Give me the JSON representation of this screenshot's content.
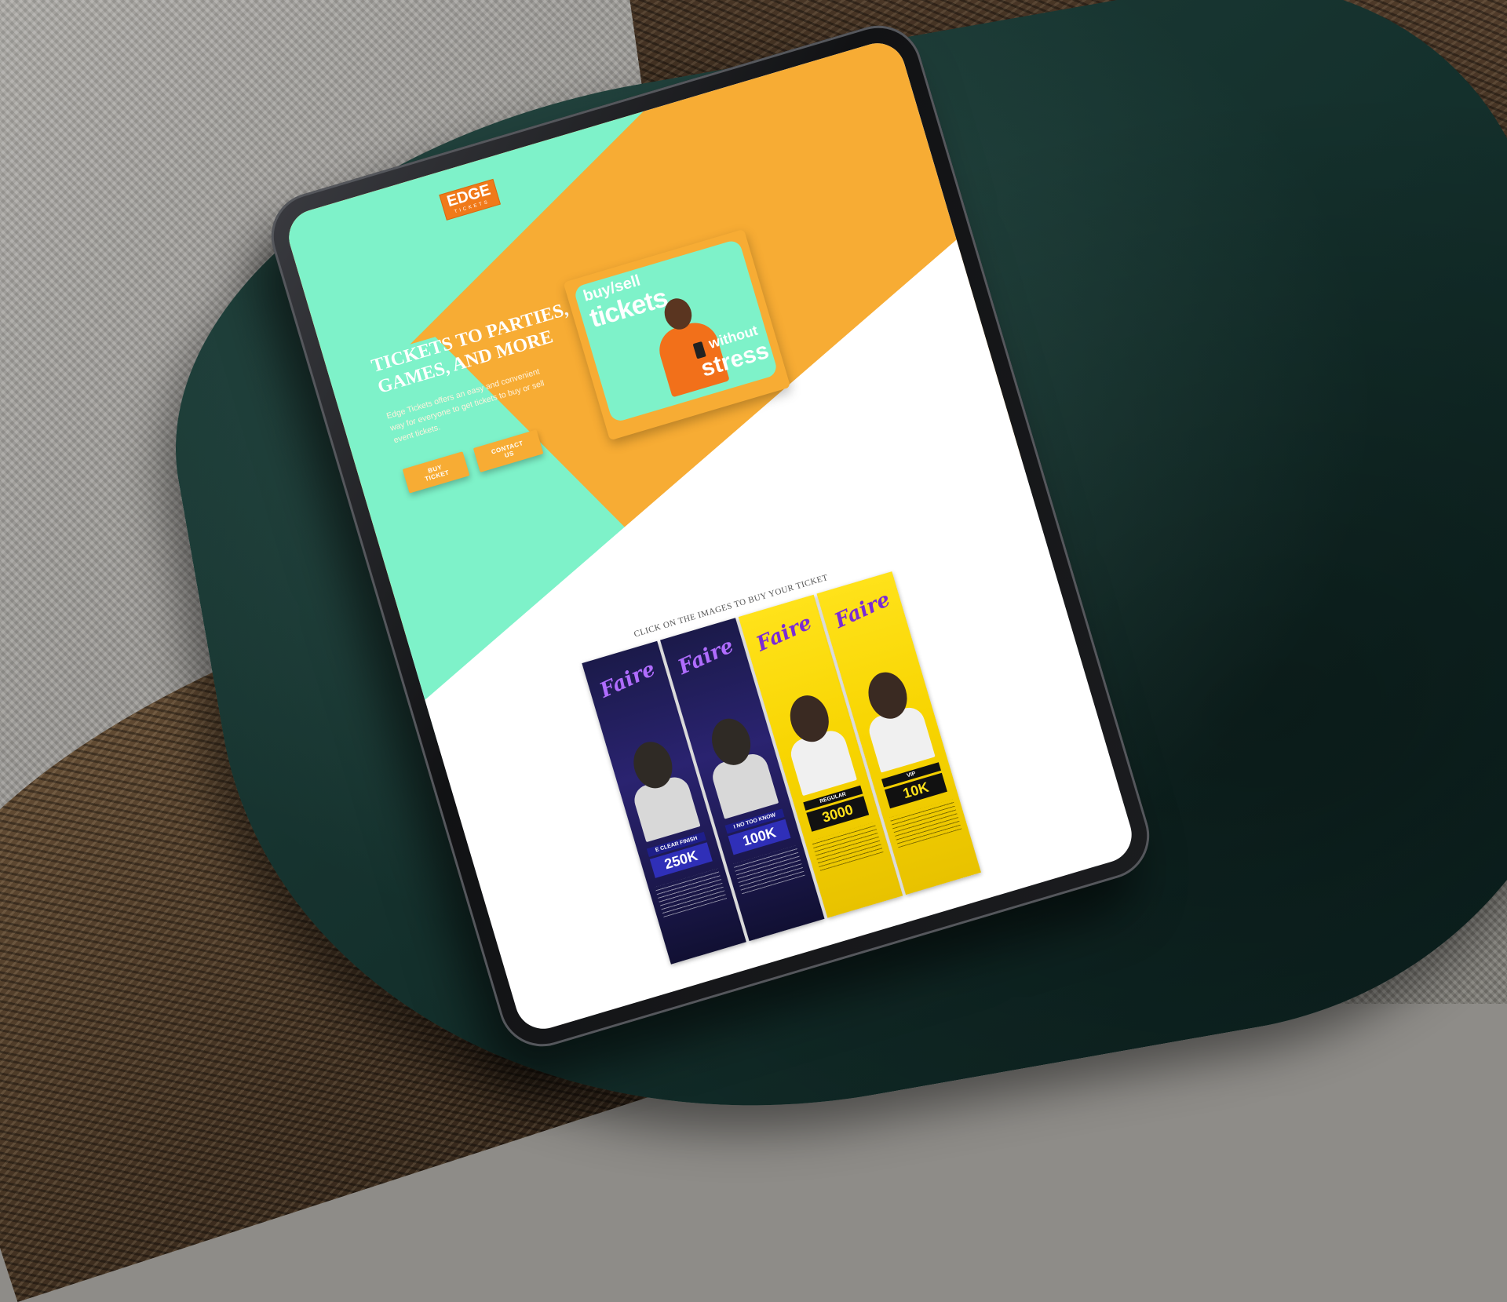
{
  "brand": {
    "logo_text": "EDGE",
    "logo_sub": "TICKETS"
  },
  "hero": {
    "title": "TICKETS TO PARTIES, GAMES, AND MORE",
    "description": "Edge Tickets offers an easy and convenient way for everyone to get tickets to buy or sell event tickets.",
    "buy_button": "BUY TICKET",
    "contact_button": "CONTACT US"
  },
  "promo": {
    "line1": "buy/sell",
    "line2": "tickets",
    "line3": "without",
    "line4": "stress"
  },
  "tickets_section": {
    "title": "CLICK ON THE IMAGES TO BUY YOUR TICKET",
    "tickets": [
      {
        "brand": "Faire",
        "tier": "E CLEAR FINISH",
        "price": "250K"
      },
      {
        "brand": "Faire",
        "tier": "I NO TOO KNOW",
        "price": "100K"
      },
      {
        "brand": "Faire",
        "tier": "REGULAR",
        "price": "3000"
      },
      {
        "brand": "Faire",
        "tier": "VIP",
        "price": "10K"
      }
    ]
  },
  "colors": {
    "accent_orange": "#f7ac34",
    "accent_mint": "#7ef2c9",
    "logo_orange": "#f07a1a"
  }
}
